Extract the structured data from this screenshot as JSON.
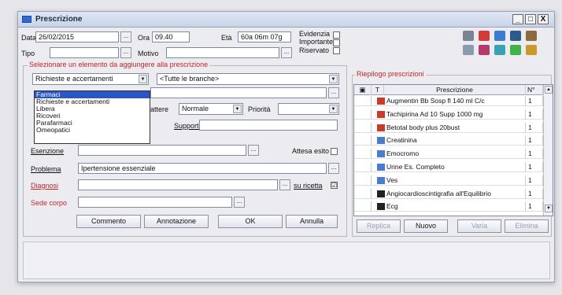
{
  "window": {
    "title": "Prescrizione"
  },
  "window_controls": {
    "minimize": "_",
    "maximize": "□",
    "close": "X"
  },
  "header": {
    "data_label": "Data",
    "data_value": "26/02/2015",
    "ora_label": "Ora",
    "ora_value": "09.40",
    "eta_label": "Età",
    "eta_value": "60a 06m 07g",
    "tipo_label": "Tipo",
    "tipo_value": "",
    "motivo_label": "Motivo",
    "motivo_value": "",
    "evidenzia_label": "Evidenzia",
    "importante_label": "Importante",
    "riservato_label": "Riservato"
  },
  "selection": {
    "legend": "Selezionare un elemento da aggiungere alla prescrizione",
    "type_value": "Richieste e accertamenti",
    "branch_value": "<Tutte le branche>",
    "dropdown_options": [
      "Farmaci",
      "Richieste e accertamenti",
      "Libera",
      "Ricoveri",
      "Parafarmaci",
      "Omeopatici"
    ],
    "dropdown_selected_index": 0,
    "carattere_label": "attere",
    "carattere_value": "Normale",
    "priorita_label": "Priorità",
    "priorita_value": "",
    "supporto_label": "Supporto",
    "supporto_value": "",
    "esenzione_label": "Esenzione",
    "esenzione_value": "",
    "attesa_label": "Attesa esito",
    "problema_label": "Problema",
    "problema_value": "Ipertensione essenziale",
    "diagnosi_label": "Diagnosi",
    "diagnosi_value": "",
    "su_ricetta_label": "su ricetta",
    "su_ricetta_checked": "☑",
    "sede_label": "Sede corpo",
    "sede_value": "",
    "ellipsis": "..."
  },
  "action_buttons": {
    "commento": "Commento",
    "annotazione": "Annotazione",
    "ok": "OK",
    "annulla": "Annulla"
  },
  "summary": {
    "legend": "Riepilogo prescrizioni",
    "columns": {
      "t": "T",
      "prescrizione": "Prescrizione",
      "n": "N°"
    },
    "rows": [
      {
        "type": "pill",
        "text": "Augmentin Bb Sosp fl 140 ml C/c",
        "n": "1"
      },
      {
        "type": "pill",
        "text": "Tachipirina Ad 10 Supp 1000 mg",
        "n": "1"
      },
      {
        "type": "pill",
        "text": "Betotal body plus 20bust",
        "n": "1"
      },
      {
        "type": "lab",
        "text": "Creatinina",
        "n": "1"
      },
      {
        "type": "lab",
        "text": "Emocromo",
        "n": "1"
      },
      {
        "type": "lab",
        "text": "Urine Es. Completo",
        "n": "1"
      },
      {
        "type": "lab",
        "text": "Ves",
        "n": "1"
      },
      {
        "type": "scan",
        "text": "Angiocardioscintigrafia all'Equilibrio",
        "n": "1"
      },
      {
        "type": "scan",
        "text": "Ecg",
        "n": "1"
      }
    ],
    "buttons": {
      "replica": "Replica",
      "nuovo": "Nuovo",
      "varia": "Varia",
      "elimina": "Elimina"
    }
  },
  "toolbar_icons": [
    "print-icon",
    "medical-cross-icon",
    "arrows-icon",
    "doctor-icon",
    "folder-icon",
    "chart-icon",
    "glasses-icon",
    "pills-icon",
    "green-circle-icon",
    "bag-icon"
  ]
}
